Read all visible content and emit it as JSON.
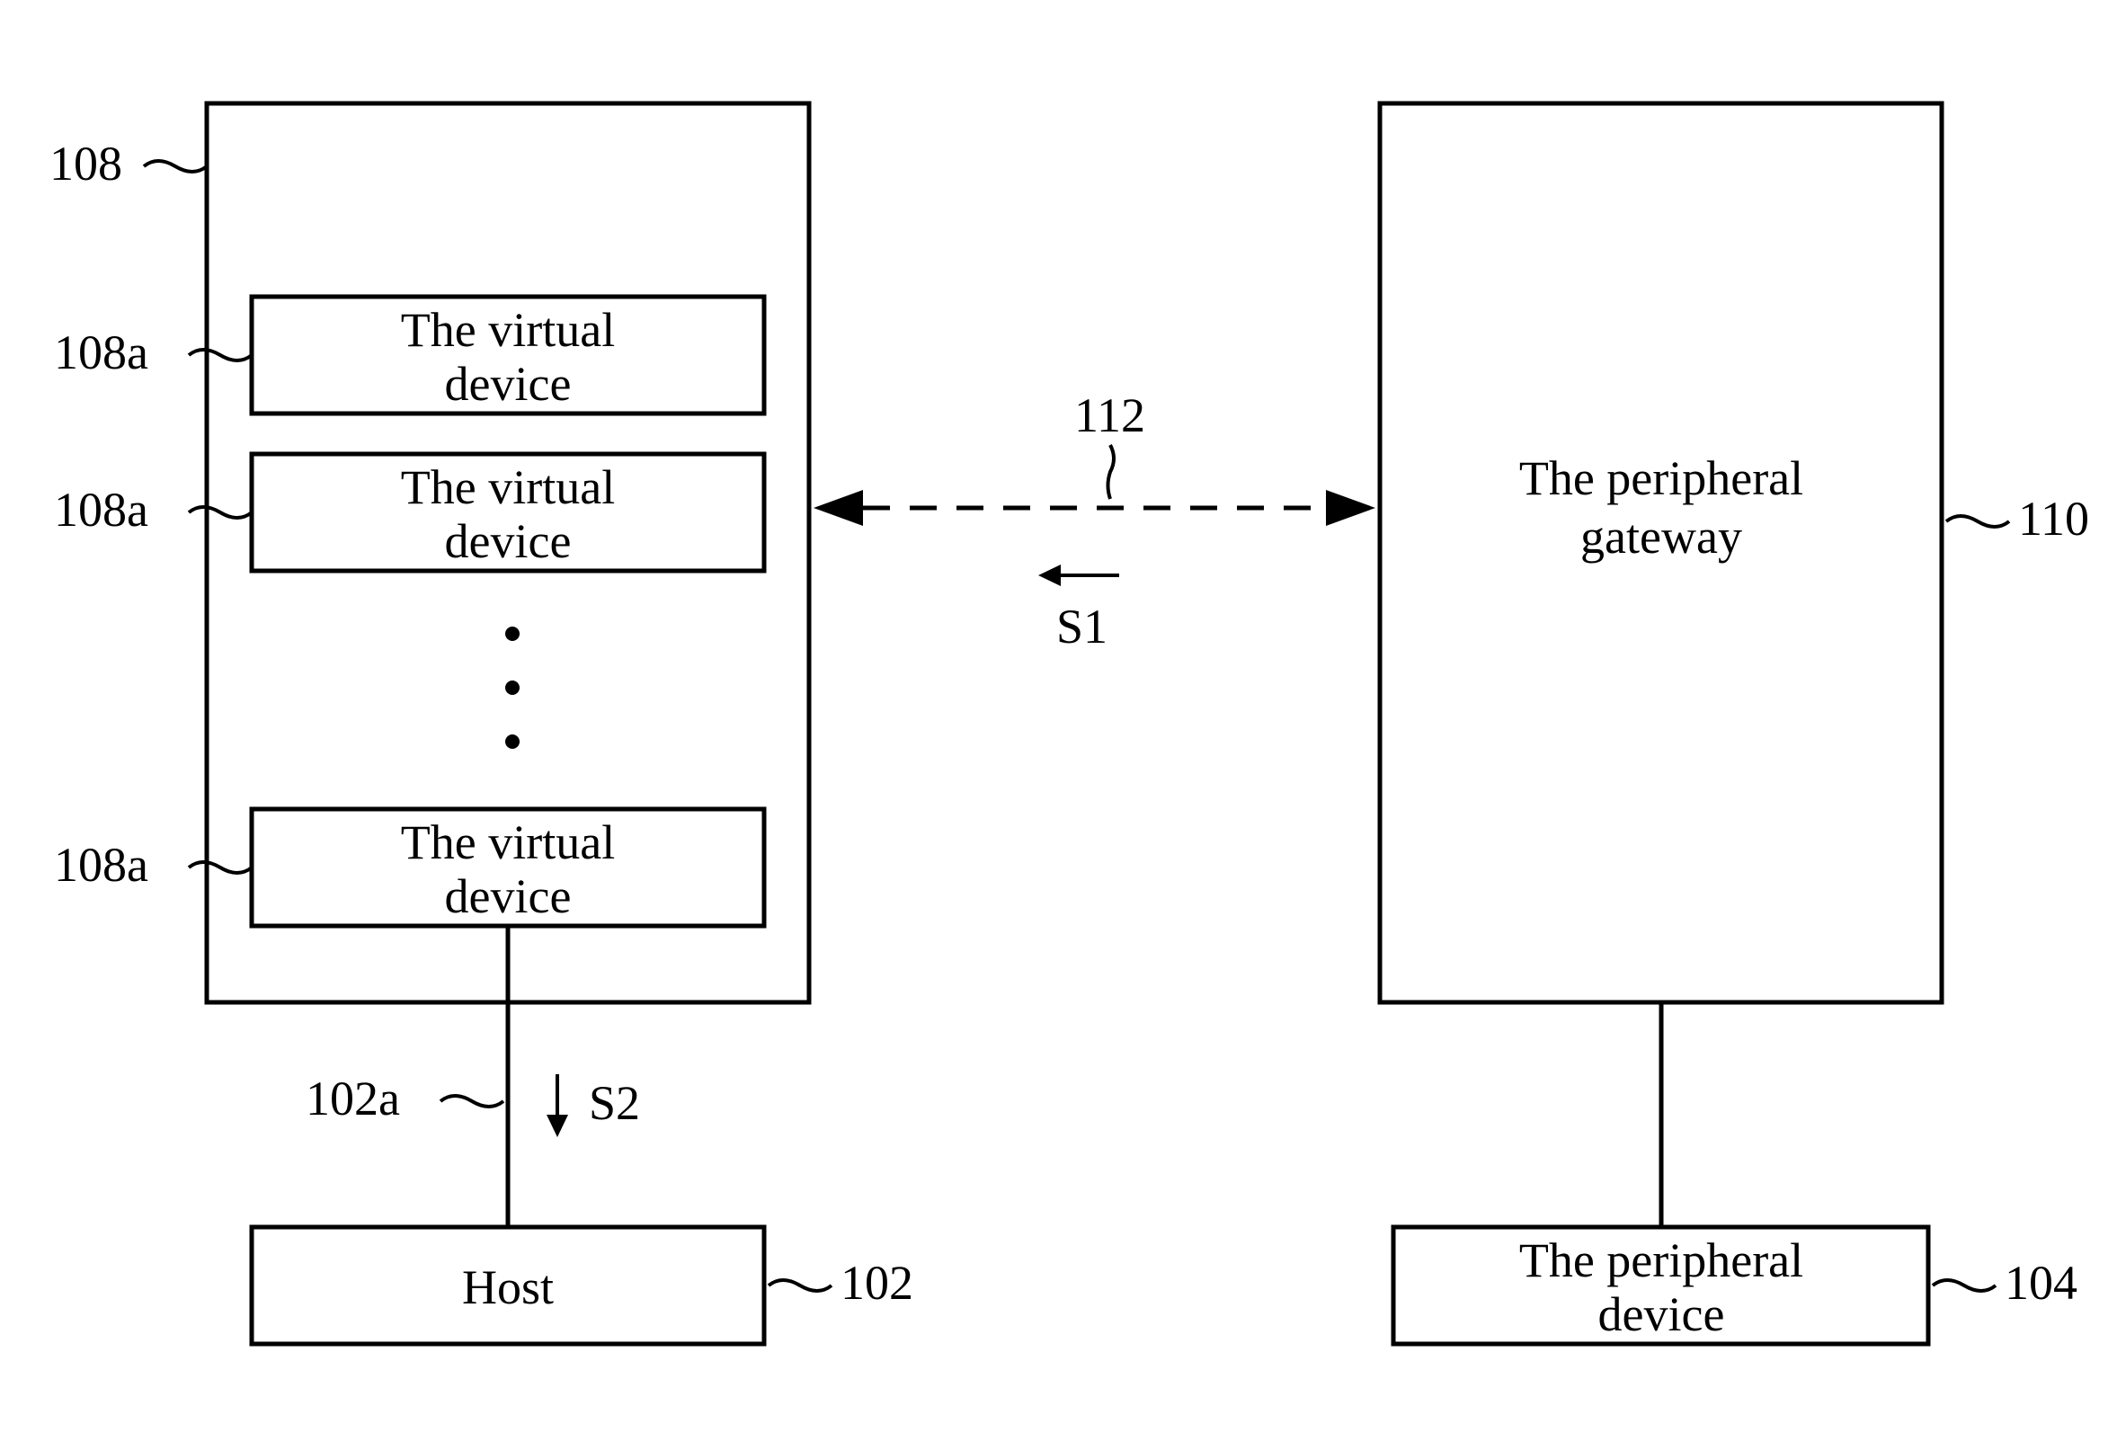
{
  "labels": {
    "ref_108": "108",
    "ref_108a_1": "108a",
    "ref_108a_2": "108a",
    "ref_108a_3": "108a",
    "ref_102a": "102a",
    "ref_102": "102",
    "ref_112": "112",
    "ref_110": "110",
    "ref_104": "104",
    "s1": "S1",
    "s2": "S2",
    "virtual_device_1a": "The virtual",
    "virtual_device_1b": "device",
    "virtual_device_2a": "The virtual",
    "virtual_device_2b": "device",
    "virtual_device_3a": "The virtual",
    "virtual_device_3b": "device",
    "peripheral_gateway_a": "The peripheral",
    "peripheral_gateway_b": "gateway",
    "host": "Host",
    "peripheral_device_a": "The peripheral",
    "peripheral_device_b": "device"
  }
}
